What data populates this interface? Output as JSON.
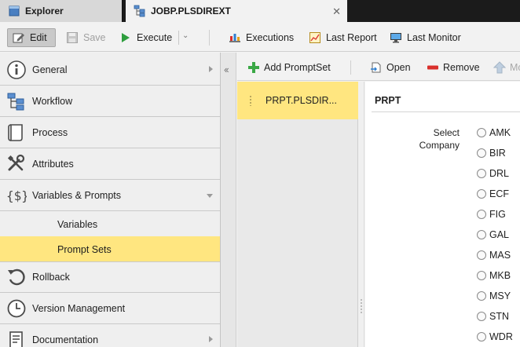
{
  "tabs": [
    {
      "label": "Explorer",
      "icon": "explorer-icon"
    },
    {
      "label": "JOBP.PLSDIREXT",
      "icon": "workflow-icon"
    }
  ],
  "toolbar": {
    "edit": "Edit",
    "save": "Save",
    "execute": "Execute",
    "executions": "Executions",
    "last_report": "Last Report",
    "last_monitor": "Last Monitor"
  },
  "nav": {
    "items": [
      {
        "label": "General",
        "icon": "info-icon"
      },
      {
        "label": "Workflow",
        "icon": "workflow-icon"
      },
      {
        "label": "Process",
        "icon": "process-icon"
      },
      {
        "label": "Attributes",
        "icon": "tools-icon"
      },
      {
        "label": "Variables & Prompts",
        "icon": "variables-icon"
      },
      {
        "label": "Rollback",
        "icon": "rollback-icon"
      },
      {
        "label": "Version Management",
        "icon": "clock-icon"
      },
      {
        "label": "Documentation",
        "icon": "documentation-icon"
      }
    ],
    "subitems": [
      {
        "label": "Variables",
        "selected": false
      },
      {
        "label": "Prompt Sets",
        "selected": true
      }
    ]
  },
  "promptsets": {
    "toolbar": {
      "add": "Add PromptSet",
      "open": "Open",
      "remove": "Remove",
      "more": "Mo"
    },
    "items": [
      {
        "label": "PRPT.PLSDIR..."
      }
    ]
  },
  "detail": {
    "title": "PRPT",
    "field_label": "Select Company",
    "options": [
      "AMK",
      "BIR",
      "DRL",
      "ECF",
      "FIG",
      "GAL",
      "MAS",
      "MKB",
      "MSY",
      "STN",
      "WDR"
    ]
  },
  "colors": {
    "selection": "#ffe680",
    "tabbar": "#1b1b1b",
    "execute_green": "#2e9e3e",
    "remove_red": "#d9302c"
  }
}
